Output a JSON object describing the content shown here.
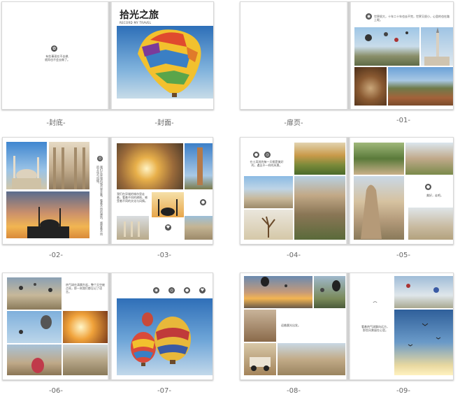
{
  "spreads": [
    {
      "id": "cover",
      "labels": [
        "-封底-",
        "-封面-"
      ]
    },
    {
      "id": "title",
      "labels": [
        "-扉页-",
        "-01-"
      ]
    },
    {
      "id": "s2",
      "labels": [
        "-02-",
        "-03-"
      ]
    },
    {
      "id": "s3",
      "labels": [
        "-04-",
        "-05-"
      ]
    },
    {
      "id": "s4",
      "labels": [
        "-06-",
        "-07-"
      ]
    },
    {
      "id": "s5",
      "labels": [
        "-08-",
        "-09-"
      ]
    }
  ],
  "cover": {
    "title_cn": "拾光之旅",
    "title_en": "RECORD MY TRAVEL",
    "back_text_1": "有些事现在不去做,",
    "back_text_2": "就再也不会去做了。"
  },
  "page01": {
    "text": "世界很大，十年二十年也去不完，世界又很小，心里的也在路上呢。"
  },
  "page02": {
    "text": "我们在异域的城市里走着，看着不同的建筑，感受着不同的文化与风情。"
  },
  "page04": {
    "text": "在土耳其的每一天都是美好的，遇见不一样的风景。"
  },
  "page05": {
    "text": "美好，走吧。"
  },
  "page06": {
    "text": "热气球在清晨升起，整个天空被点亮，那一刻我们都忘记了语言。"
  },
  "page08": {
    "text": "迎着晨光出发。"
  },
  "page09": {
    "text": "看着热气球飘向远方，那些风景留在心里。"
  },
  "icons": [
    "balloon-icon",
    "camera-icon",
    "pin-icon",
    "heart-icon"
  ]
}
